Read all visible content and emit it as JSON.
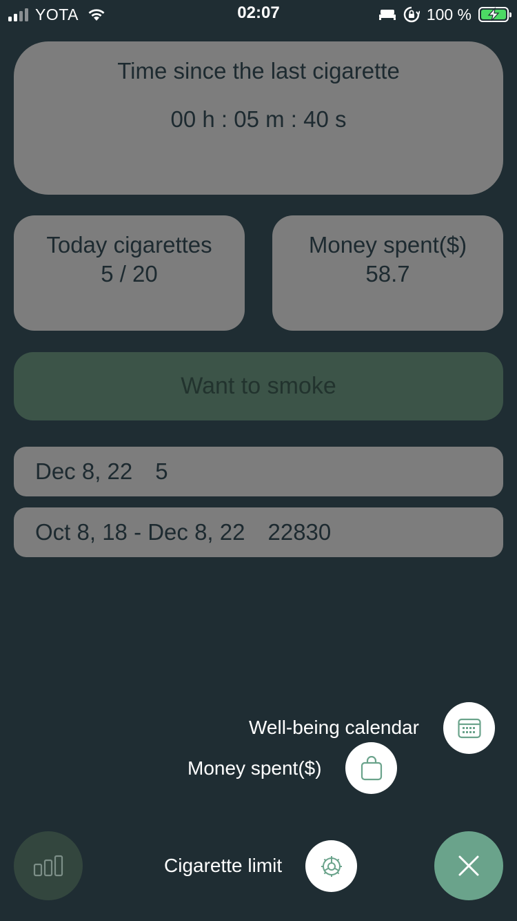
{
  "status_bar": {
    "carrier": "YOTA",
    "time": "02:07",
    "battery_percent": "100 %",
    "signal_icon": "signal-bars-icon",
    "wifi_icon": "wifi-icon",
    "sleep_icon": "bed-icon",
    "lock_icon": "orientation-lock-icon",
    "battery_icon": "battery-charging-icon"
  },
  "timer": {
    "title": "Time since the last cigarette",
    "value": "00 h : 05 m : 40 s"
  },
  "today": {
    "title": "Today cigarettes",
    "value": "5 / 20"
  },
  "money": {
    "title": "Money spent($)",
    "value": "58.7"
  },
  "smoke_button": {
    "label": "Want to smoke"
  },
  "history": [
    {
      "period": "Dec 8, 22",
      "count": "5"
    },
    {
      "period": "Oct 8, 18 - Dec 8, 22",
      "count": "22830"
    }
  ],
  "fab_menu": {
    "calendar_label": "Well-being calendar",
    "money_label": "Money spent($)",
    "limit_label": "Cigarette limit",
    "calendar_icon": "calendar-icon",
    "money_icon": "shopping-bag-icon",
    "limit_icon": "gear-icon",
    "close_icon": "close-icon",
    "stats_icon": "bar-chart-icon"
  },
  "colors": {
    "background": "#1f2d33",
    "card": "#7d7d7d",
    "accent": "#6aa38b",
    "smoke_button": "#3c5448",
    "battery": "#4cd964"
  }
}
